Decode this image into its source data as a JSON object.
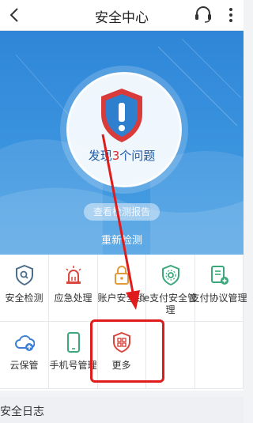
{
  "header": {
    "title": "安全中心",
    "back_icon": "back-chevron-icon",
    "service_icon": "headset-icon",
    "menu_icon": "more-dots-icon"
  },
  "hero": {
    "issue_prefix": "发现",
    "issue_count": "3",
    "issue_suffix": "个问题",
    "report_label": "查看检测报告",
    "recheck_label": "重新检测",
    "colors": {
      "background": "#3a93de",
      "shield": "#d93a3a",
      "issue_count": "#e02b2b"
    }
  },
  "grid": {
    "items": [
      {
        "label": "安全检测",
        "icon": "shield-scan-icon"
      },
      {
        "label": "应急处理",
        "icon": "alarm-light-icon"
      },
      {
        "label": "账户安全锁",
        "icon": "lock-icon"
      },
      {
        "label": "e支付安全管理",
        "icon": "gear-shield-icon"
      },
      {
        "label": "支付协议管理",
        "icon": "document-plus-icon"
      },
      {
        "label": "云保管",
        "icon": "cloud-upload-icon"
      },
      {
        "label": "手机号管理",
        "icon": "phone-icon"
      },
      {
        "label": "更多",
        "icon": "grid-shield-icon"
      }
    ]
  },
  "log": {
    "title": "安全日志"
  },
  "annotation": {
    "color": "#e01b1b"
  }
}
